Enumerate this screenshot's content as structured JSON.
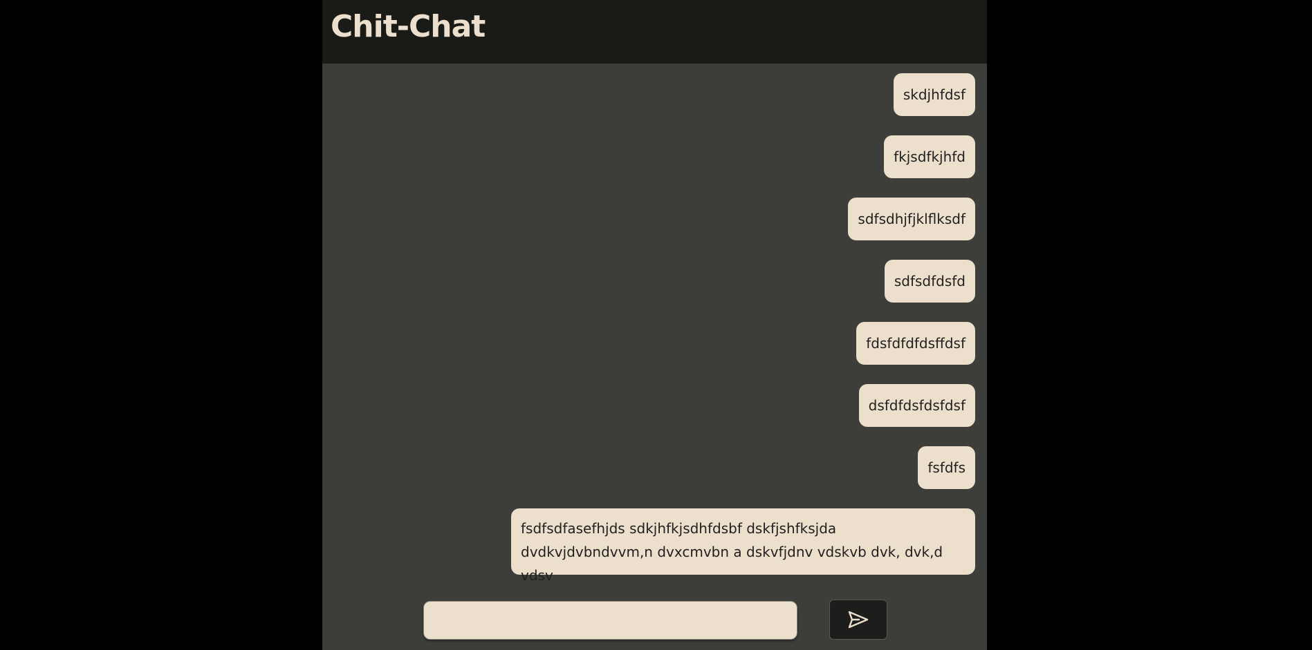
{
  "header": {
    "title": "Chit-Chat"
  },
  "messages": [
    "skdjhfdsf",
    "fkjsdfkjhfd",
    "sdfsdhjfjklflksdf",
    "sdfsdfdsfd",
    "fdsfdfdfdsffdsf",
    "dsfdfdsfdsfdsf",
    "fsfdfs",
    "fsdfsdfasefhjds sdkjhfkjsdhfdsbf dskfjshfksjda dvdkvjdvbndvvm,n dvxcmvbn a dskvfjdnv vdskvb dvk, dvk,d vdsv"
  ],
  "composer": {
    "input_value": "",
    "send_icon": "send-icon"
  },
  "colors": {
    "page_background": "#000000",
    "app_background": "#3d3e39",
    "header_background": "#1a1b17",
    "title_color": "#ecdfcd",
    "bubble_background": "#ece0cd",
    "send_button_background": "#1d1e1b",
    "send_icon_color": "#ecdfcd"
  }
}
